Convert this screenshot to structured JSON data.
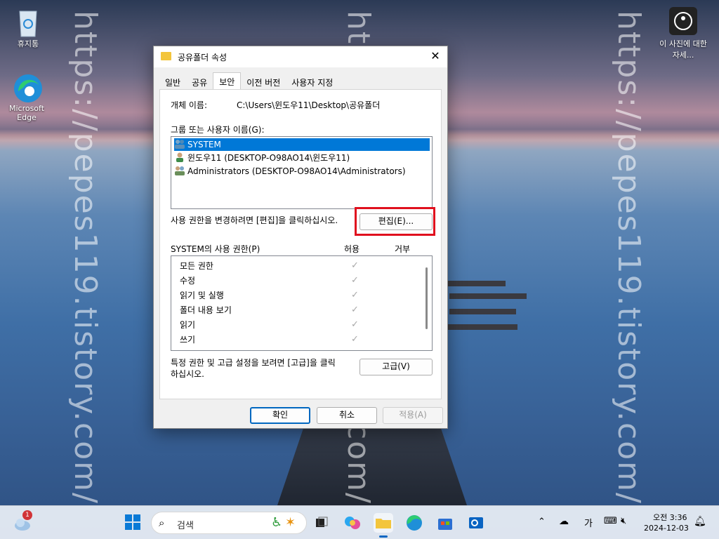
{
  "desktop": {
    "icons": [
      {
        "label": "휴지통"
      },
      {
        "label": "Microsoft Edge"
      },
      {
        "label": "이 사진에 대한 자세..."
      }
    ],
    "watermark": "https://pepes119.tistory.com/"
  },
  "dialog": {
    "title": "공유폴더 속성",
    "close_label": "✕",
    "tabs": [
      {
        "label": "일반"
      },
      {
        "label": "공유"
      },
      {
        "label": "보안"
      },
      {
        "label": "이전 버전"
      },
      {
        "label": "사용자 지정"
      }
    ],
    "object_name_label": "개체 이름:",
    "object_name_value": "C:\\Users\\윈도우11\\Desktop\\공유폴더",
    "group_label": "그룹 또는 사용자 이름(G):",
    "users": [
      {
        "label": "SYSTEM"
      },
      {
        "label": "윈도우11 (DESKTOP-O98AO14\\윈도우11)"
      },
      {
        "label": "Administrators (DESKTOP-O98AO14\\Administrators)"
      }
    ],
    "edit_hint": "사용 권한을 변경하려면 [편집]을 클릭하십시오.",
    "edit_button": "편집(E)...",
    "permissions_label": "SYSTEM의 사용 권한(P)",
    "allow_header": "허용",
    "deny_header": "거부",
    "permissions": [
      {
        "label": "모든 권한",
        "allow": true
      },
      {
        "label": "수정",
        "allow": true
      },
      {
        "label": "읽기 및 실행",
        "allow": true
      },
      {
        "label": "폴더 내용 보기",
        "allow": true
      },
      {
        "label": "읽기",
        "allow": true
      },
      {
        "label": "쓰기",
        "allow": true
      }
    ],
    "advanced_hint_line1": "특정 권한 및 고급 설정을 보려면 [고급]을 클릭",
    "advanced_hint_line2": "하십시오.",
    "advanced_button": "고급(V)",
    "ok_button": "확인",
    "cancel_button": "취소",
    "apply_button": "적용(A)"
  },
  "taskbar": {
    "search_placeholder": "검색",
    "weather_badge": "1",
    "ime_label": "가",
    "time": "오전 3:36",
    "date": "2024-12-03"
  }
}
